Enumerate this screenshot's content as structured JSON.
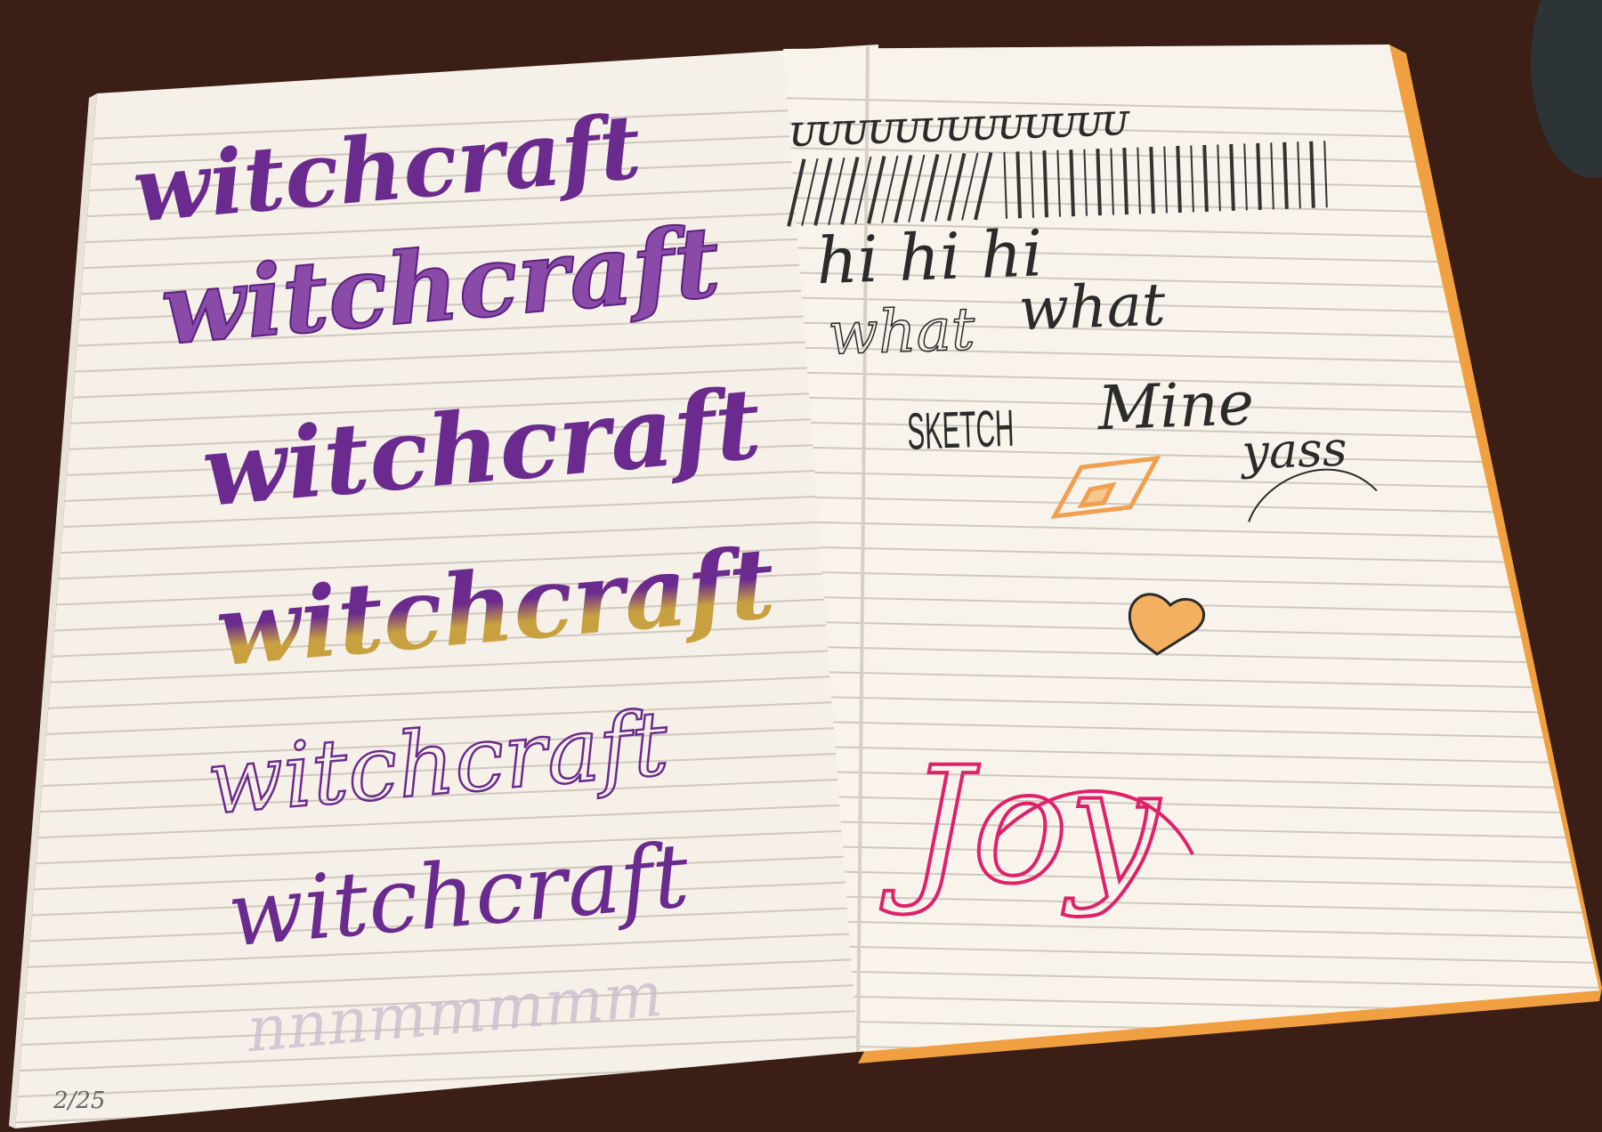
{
  "colors": {
    "table": "#3b1e15",
    "paper": "#f6f1e8",
    "rule_line": "#c9c3bb",
    "page_edge": "#f0a040",
    "purple_ink": "#6a2a8e",
    "gold_ink": "#c9a040",
    "black_ink": "#2b2b2b",
    "pink_ink": "#e0206a",
    "orange_pencil": "#f0a050"
  },
  "left_page": {
    "lettering": [
      {
        "text": "witchcraft",
        "style": "brush-purple"
      },
      {
        "text": "witchcraft",
        "style": "brush-purple-outlined"
      },
      {
        "text": "witchcraft",
        "style": "brush-purple-bold"
      },
      {
        "text": "witchcraft",
        "style": "purple-to-gold-ombre"
      },
      {
        "text": "witchcraft",
        "style": "faux-calligraphy-outline"
      },
      {
        "text": "witchcraft",
        "style": "faux-calligraphy-thin"
      }
    ],
    "drill_strokes": "ոոոmmmmm",
    "page_number": "2/25"
  },
  "right_page": {
    "drill_top": "ᴜᴜᴜᴜᴜᴜᴜᴜᴜᴜᴜᴜᴜ",
    "hi_line": "hi hi hi",
    "what_line": [
      "what",
      "what"
    ],
    "sketch": "SKETCH",
    "mine": "Mine",
    "yass": "yass",
    "joy": "Joy"
  }
}
